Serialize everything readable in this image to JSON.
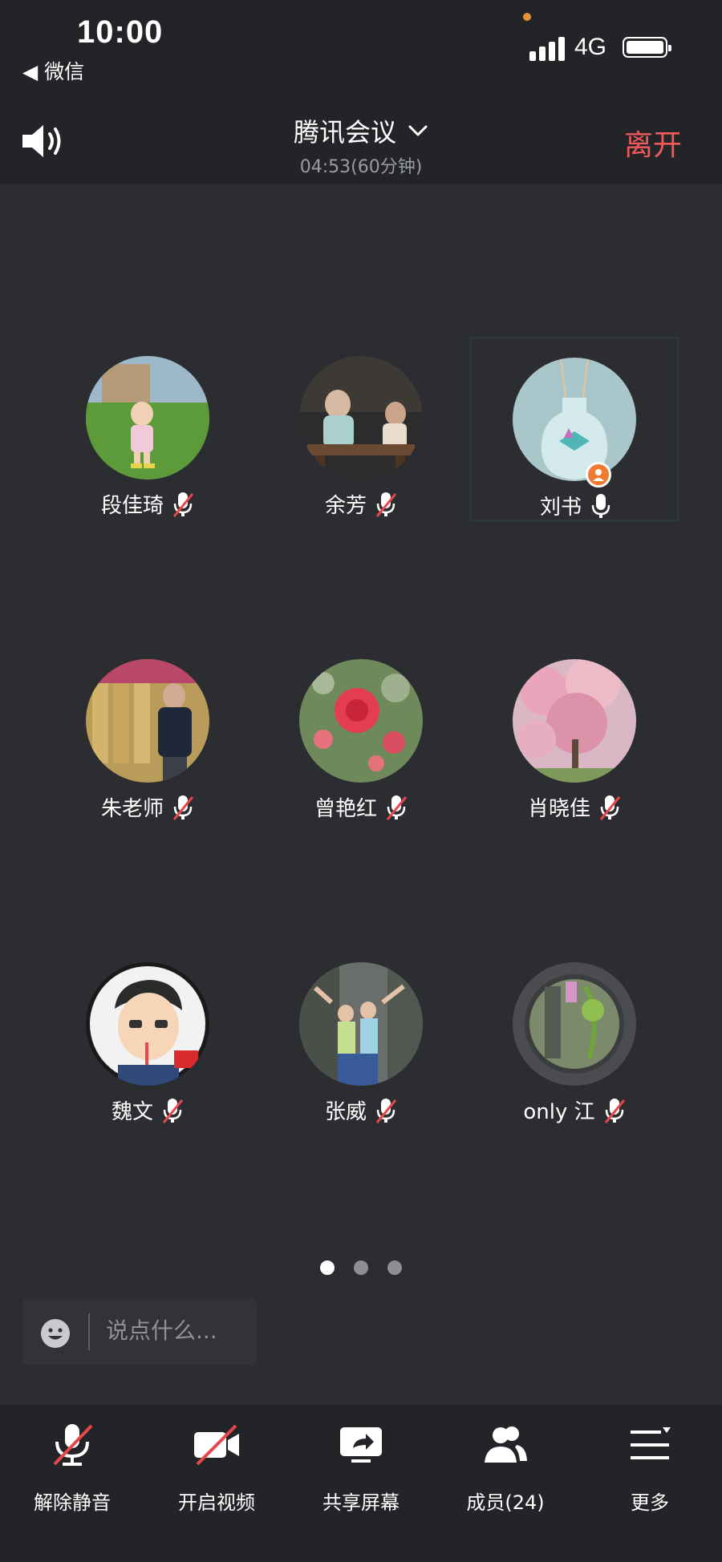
{
  "status": {
    "time": "10:00",
    "back_app": "◀ 微信",
    "network": "4G"
  },
  "meeting": {
    "title": "腾讯会议",
    "timer": "04:53(60分钟)",
    "leave": "离开"
  },
  "members": [
    {
      "name": "段佳琦",
      "mic": "muted",
      "icon": "baby-photo"
    },
    {
      "name": "余芳",
      "mic": "muted",
      "icon": "tea-photo"
    },
    {
      "name": "刘书",
      "mic": "on",
      "host": true,
      "icon": "bottle-photo"
    },
    {
      "name": "朱老师",
      "mic": "muted",
      "icon": "man-photo"
    },
    {
      "name": "曾艳红",
      "mic": "muted",
      "icon": "flower-photo"
    },
    {
      "name": "肖晓佳",
      "mic": "muted",
      "icon": "blossom-photo"
    },
    {
      "name": "魏文",
      "mic": "muted",
      "icon": "cartoon-avatar"
    },
    {
      "name": "张威",
      "mic": "muted",
      "icon": "family-photo"
    },
    {
      "name": "only 江",
      "mic": "muted",
      "icon": "garden-photo"
    }
  ],
  "pager": {
    "count": 3,
    "active": 0
  },
  "chat": {
    "placeholder": "说点什么..."
  },
  "toolbar": {
    "unmute": "解除静音",
    "video": "开启视频",
    "share": "共享屏幕",
    "members": "成员(24)",
    "more": "更多"
  },
  "colors": {
    "background": "#2b2d31",
    "bar": "#232428",
    "leave": "#f05a5a",
    "host_badge": "#f07a2e"
  }
}
